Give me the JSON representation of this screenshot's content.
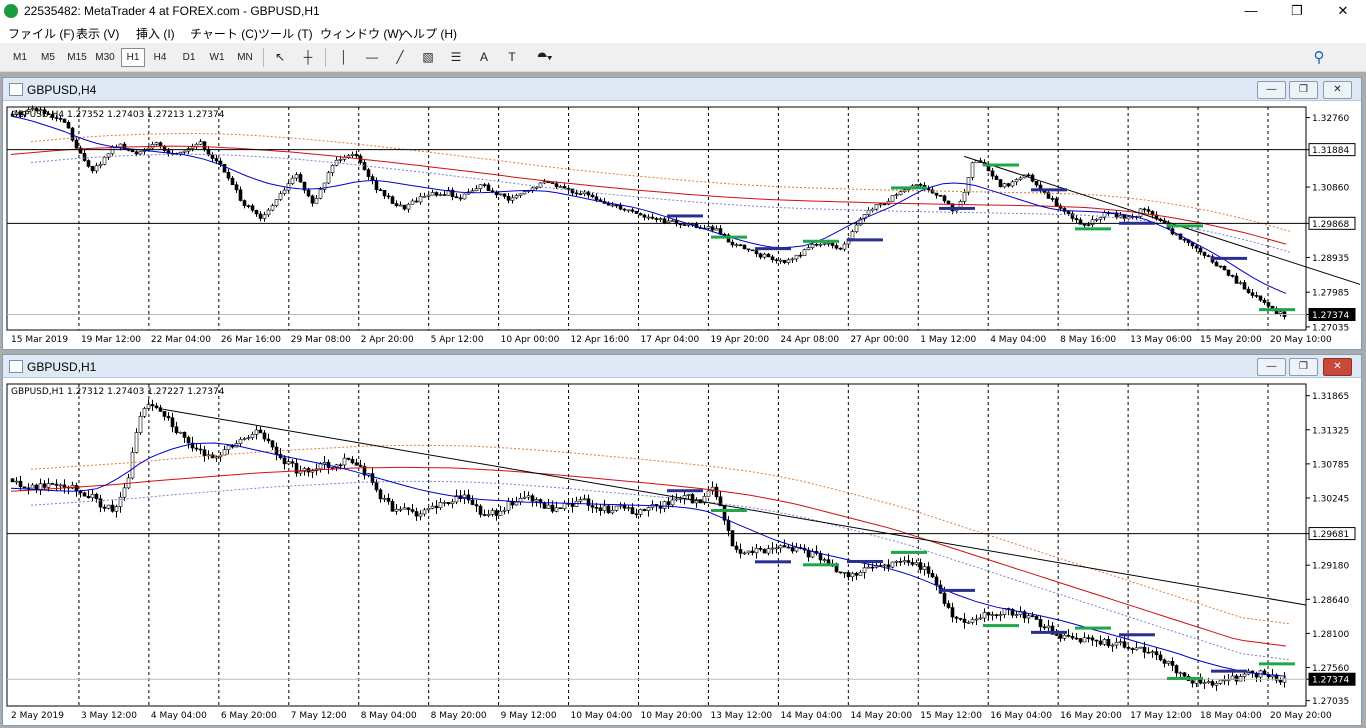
{
  "window": {
    "title": "22535482: MetaTrader 4 at FOREX.com - GBPUSD,H1",
    "controls": {
      "minimize": "—",
      "maximize": "❐",
      "close": "✕"
    }
  },
  "menu": [
    "ファイル (F)",
    "表示 (V)",
    "挿入 (I)",
    "チャート (C)",
    "ツール (T)",
    "ウィンドウ (W)",
    "ヘルプ (H)"
  ],
  "toolbar": {
    "timeframes": [
      "M1",
      "M5",
      "M15",
      "M30",
      "H1",
      "H4",
      "D1",
      "W1",
      "MN"
    ],
    "selected_timeframe": "H1",
    "tools": [
      {
        "name": "cursor-icon",
        "glyph": "↖"
      },
      {
        "name": "crosshair-icon",
        "glyph": "┼"
      },
      {
        "name": "vertical-line-icon",
        "glyph": "│"
      },
      {
        "name": "horizontal-line-icon",
        "glyph": "—"
      },
      {
        "name": "trendline-icon",
        "glyph": "╱"
      },
      {
        "name": "equidistant-channel-icon",
        "glyph": "▧"
      },
      {
        "name": "fibonacci-icon",
        "glyph": "☰"
      },
      {
        "name": "text-icon",
        "glyph": "A"
      },
      {
        "name": "text-label-icon",
        "glyph": "T"
      },
      {
        "name": "shapes-icon",
        "glyph": "⯊▾"
      }
    ],
    "search_icon": "⚲"
  },
  "colors": {
    "candle": "#000000",
    "ma_blue": "#0000cc",
    "ma_red": "#d01010",
    "cloud": "#e07a3c",
    "cloud2": "#8080cc",
    "level_blue": "#2a2f8f",
    "level_green": "#1ea64a",
    "price_label_bg": "#000000"
  },
  "charts": [
    {
      "window_title": "GBPUSD,H4",
      "info": "GBPUSD,H4  1.27352 1.27403 1.27213 1.27374",
      "price_labels": [
        "1.32760",
        "1.31884",
        "1.30860",
        "1.29868",
        "1.28935",
        "1.27985",
        "1.27374",
        "1.27035"
      ],
      "highlight_prices": [
        "1.31884",
        "1.29868",
        "1.27374"
      ],
      "time_labels": [
        "15 Mar 2019",
        "19 Mar 12:00",
        "22 Mar 04:00",
        "26 Mar 16:00",
        "29 Mar 08:00",
        "2 Apr 20:00",
        "5 Apr 12:00",
        "10 Apr 00:00",
        "12 Apr 16:00",
        "17 Apr 04:00",
        "19 Apr 20:00",
        "24 Apr 08:00",
        "27 Apr 00:00",
        "1 May 12:00",
        "4 May 04:00",
        "8 May 16:00",
        "13 May 06:00",
        "15 May 20:00",
        "20 May 10:00"
      ],
      "chart_data": {
        "type": "candlestick",
        "symbol": "GBPUSD",
        "timeframe": "H4",
        "last": {
          "open": 1.27352,
          "high": 1.27403,
          "low": 1.27213,
          "close": 1.27374
        },
        "ylim": [
          1.2695,
          1.3305
        ],
        "close_series": [
          1.3285,
          1.329,
          1.33,
          1.3298,
          1.328,
          1.327,
          1.3262,
          1.32,
          1.316,
          1.3135,
          1.315,
          1.319,
          1.32,
          1.3185,
          1.3178,
          1.3195,
          1.3205,
          1.3188,
          1.3175,
          1.3185,
          1.3195,
          1.321,
          1.3175,
          1.316,
          1.312,
          1.308,
          1.304,
          1.302,
          1.2995,
          1.303,
          1.306,
          1.3095,
          1.312,
          1.3065,
          1.304,
          1.3095,
          1.315,
          1.317,
          1.318,
          1.3165,
          1.312,
          1.308,
          1.306,
          1.304,
          1.303,
          1.3045,
          1.306,
          1.307,
          1.306,
          1.3075,
          1.305,
          1.307,
          1.3085,
          1.309,
          1.307,
          1.306,
          1.305,
          1.3065,
          1.3075,
          1.309,
          1.31,
          1.3095,
          1.308,
          1.3075,
          1.307,
          1.306,
          1.3045,
          1.304,
          1.3035,
          1.3025,
          1.302,
          1.3005,
          1.3,
          1.2995,
          1.299,
          1.2985,
          1.2982,
          1.2978,
          1.2975,
          1.297,
          1.295,
          1.293,
          1.292,
          1.291,
          1.29,
          1.2895,
          1.2885,
          1.288,
          1.2895,
          1.291,
          1.293,
          1.2935,
          1.2925,
          1.292,
          1.294,
          1.2985,
          1.3015,
          1.3035,
          1.304,
          1.306,
          1.3075,
          1.3085,
          1.309,
          1.308,
          1.3065,
          1.304,
          1.302,
          1.3065,
          1.316,
          1.315,
          1.312,
          1.309,
          1.3095,
          1.311,
          1.312,
          1.31,
          1.307,
          1.305,
          1.302,
          1.3005,
          1.299,
          1.2985,
          1.3,
          1.3015,
          1.301,
          1.3005,
          1.3,
          1.3025,
          1.3015,
          1.2995,
          1.297,
          1.295,
          1.2935,
          1.292,
          1.29,
          1.288,
          1.286,
          1.284,
          1.282,
          1.28,
          1.278,
          1.2765,
          1.2745,
          1.2737
        ],
        "ma_fast": [
          1.328,
          1.327,
          1.3255,
          1.324,
          1.322,
          1.3205,
          1.3195,
          1.319,
          1.3185,
          1.318,
          1.3175,
          1.3165,
          1.315,
          1.313,
          1.311,
          1.3095,
          1.3085,
          1.308,
          1.3082,
          1.309,
          1.31,
          1.3105,
          1.31,
          1.3092,
          1.3085,
          1.3078,
          1.3072,
          1.307,
          1.3072,
          1.3075,
          1.3077,
          1.3075,
          1.3068,
          1.3058,
          1.3048,
          1.304,
          1.3032,
          1.302,
          1.3005,
          1.299,
          1.2975,
          1.296,
          1.2945,
          1.2932,
          1.2922,
          1.292,
          1.2925,
          1.294,
          1.2965,
          1.299,
          1.301,
          1.303,
          1.3055,
          1.308,
          1.3095,
          1.3098,
          1.309,
          1.3075,
          1.306,
          1.3045,
          1.303,
          1.3022,
          1.302,
          1.3018,
          1.3015,
          1.3008,
          1.2995,
          1.2975,
          1.295,
          1.2925,
          1.29,
          1.287,
          1.284,
          1.2815,
          1.2795
        ],
        "ma_slow": [
          1.3175,
          1.3185,
          1.3192,
          1.3196,
          1.3198,
          1.3196,
          1.319,
          1.3182,
          1.3172,
          1.316,
          1.3148,
          1.3135,
          1.3122,
          1.3108,
          1.3096,
          1.3085,
          1.3075,
          1.3066,
          1.3058,
          1.3052,
          1.3048,
          1.3045,
          1.3042,
          1.304,
          1.3038,
          1.3036,
          1.3034,
          1.303,
          1.302,
          1.3005,
          1.2985,
          1.296,
          1.293
        ],
        "levels": [
          1.31884,
          1.29868,
          1.27374
        ],
        "trendline": {
          "from": [
            14.0,
            1.317
          ],
          "to": [
            20.2,
            1.2795
          ]
        }
      }
    },
    {
      "window_title": "GBPUSD,H1",
      "info": "GBPUSD,H1  1.27312 1.27403 1.27227 1.27374",
      "price_labels": [
        "1.31865",
        "1.31325",
        "1.30785",
        "1.30245",
        "1.29681",
        "1.29180",
        "1.28640",
        "1.28100",
        "1.27560",
        "1.27374",
        "1.27035"
      ],
      "highlight_prices": [
        "1.29681",
        "1.27374"
      ],
      "time_labels": [
        "2 May 2019",
        "3 May 12:00",
        "4 May 04:00",
        "6 May 20:00",
        "7 May 12:00",
        "8 May 04:00",
        "8 May 20:00",
        "9 May 12:00",
        "10 May 04:00",
        "10 May 20:00",
        "13 May 12:00",
        "14 May 04:00",
        "14 May 20:00",
        "15 May 12:00",
        "16 May 04:00",
        "16 May 20:00",
        "17 May 12:00",
        "18 May 04:00",
        "20 May 20:00"
      ],
      "chart_data": {
        "type": "candlestick",
        "symbol": "GBPUSD",
        "timeframe": "H1",
        "last": {
          "open": 1.27312,
          "high": 1.27403,
          "low": 1.27227,
          "close": 1.27374
        },
        "ylim": [
          1.2695,
          1.3205
        ],
        "close_series": [
          1.3055,
          1.3045,
          1.304,
          1.3048,
          1.305,
          1.3045,
          1.3035,
          1.3025,
          1.301,
          1.3005,
          1.3045,
          1.315,
          1.3175,
          1.3165,
          1.314,
          1.3115,
          1.31,
          1.309,
          1.3095,
          1.3105,
          1.3115,
          1.313,
          1.312,
          1.3095,
          1.308,
          1.3065,
          1.307,
          1.308,
          1.3075,
          1.3085,
          1.308,
          1.306,
          1.303,
          1.301,
          1.3005,
          1.3,
          1.3005,
          1.301,
          1.3015,
          1.303,
          1.302,
          1.2995,
          1.3,
          1.301,
          1.302,
          1.3025,
          1.3015,
          1.3005,
          1.301,
          1.3015,
          1.302,
          1.301,
          1.3005,
          1.3015,
          1.3,
          1.3005,
          1.301,
          1.3015,
          1.302,
          1.3025,
          1.3015,
          1.304,
          1.3,
          1.294,
          1.2935,
          1.294,
          1.2945,
          1.295,
          1.2945,
          1.2938,
          1.2935,
          1.2925,
          1.291,
          1.2905,
          1.2908,
          1.2915,
          1.2918,
          1.292,
          1.2922,
          1.2918,
          1.291,
          1.287,
          1.284,
          1.2825,
          1.2835,
          1.284,
          1.2842,
          1.2845,
          1.284,
          1.2835,
          1.282,
          1.281,
          1.28,
          1.28,
          1.2802,
          1.2798,
          1.2795,
          1.279,
          1.2785,
          1.278,
          1.2775,
          1.276,
          1.2745,
          1.2735,
          1.273,
          1.2732,
          1.2735,
          1.274,
          1.2748,
          1.2745,
          1.274,
          1.2737
        ],
        "ma_fast": [
          1.304,
          1.3038,
          1.3036,
          1.3035,
          1.304,
          1.306,
          1.3085,
          1.31,
          1.311,
          1.3112,
          1.3108,
          1.31,
          1.3092,
          1.3085,
          1.3078,
          1.307,
          1.306,
          1.305,
          1.304,
          1.3032,
          1.3026,
          1.3022,
          1.302,
          1.3018,
          1.3017,
          1.3016,
          1.3015,
          1.3014,
          1.3013,
          1.3012,
          1.301,
          1.3005,
          1.299,
          1.2975,
          1.296,
          1.2948,
          1.2938,
          1.293,
          1.2922,
          1.2915,
          1.2905,
          1.2892,
          1.2875,
          1.2862,
          1.2852,
          1.2845,
          1.2838,
          1.283,
          1.282,
          1.281,
          1.28,
          1.279,
          1.278,
          1.2768,
          1.2758,
          1.275,
          1.2745,
          1.2742
        ],
        "ma_slow": [
          1.3035,
          1.304,
          1.3045,
          1.3052,
          1.3058,
          1.3064,
          1.3068,
          1.3072,
          1.3073,
          1.3072,
          1.3068,
          1.3062,
          1.3055,
          1.3048,
          1.304,
          1.303,
          1.3015,
          1.2995,
          1.2975,
          1.295,
          1.2925,
          1.29,
          1.2875,
          1.285,
          1.2825,
          1.28,
          1.279
        ],
        "levels": [
          1.29681,
          1.27374
        ],
        "trendline": {
          "from": [
            0.12,
            1.3165
          ],
          "to": [
            1.0,
            1.2855
          ]
        }
      }
    }
  ]
}
